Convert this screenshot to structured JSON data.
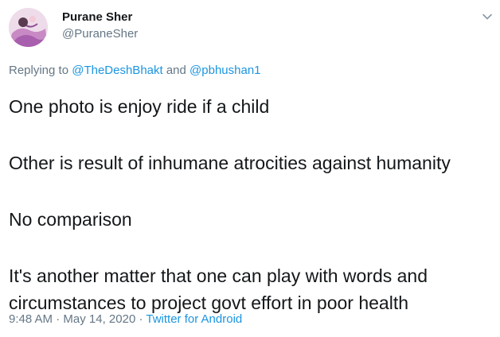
{
  "author": {
    "display_name": "Purane Sher",
    "handle": "@PuraneSher",
    "avatar_icon": "avatar-image"
  },
  "menu_icon": "chevron-down-icon",
  "reply": {
    "prefix": "Replying to ",
    "mention_1": "@TheDeshBhakt",
    "conjunction": " and ",
    "mention_2": "@pbhushan1"
  },
  "body": {
    "paragraph_1": "One photo is enjoy ride if a child",
    "paragraph_2": "Other is result of inhumane atrocities against humanity",
    "paragraph_3": "No comparison",
    "paragraph_4_line_1": "It's another matter that one can play with words and",
    "paragraph_4_line_2": "circumstances to project govt effort in poor health"
  },
  "meta": {
    "time": "9:48 AM",
    "separator": " · ",
    "date": "May 14, 2020",
    "source": "Twitter for Android"
  },
  "colors": {
    "text": "#14171a",
    "muted": "#657786",
    "link": "#1b95e0"
  }
}
